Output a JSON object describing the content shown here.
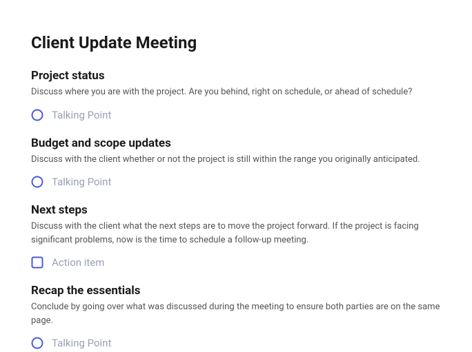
{
  "title": "Client Update Meeting",
  "sections": [
    {
      "heading": "Project status",
      "description": "Discuss where you are with the project. Are you behind, right on schedule, or ahead of schedule?",
      "item": {
        "type": "talking-point",
        "placeholder": "Talking Point"
      }
    },
    {
      "heading": "Budget and scope updates",
      "description": "Discuss with the client whether or not the project is still within the range you originally anticipated.",
      "item": {
        "type": "talking-point",
        "placeholder": "Talking Point"
      }
    },
    {
      "heading": "Next steps",
      "description": "Discuss with the client what the next steps are to move the project forward. If the project is facing significant problems, now is the time to schedule a follow-up meeting.",
      "item": {
        "type": "action-item",
        "placeholder": "Action item"
      }
    },
    {
      "heading": "Recap the essentials",
      "description": "Conclude by going over what was discussed during the meeting to ensure both parties are on the same page.",
      "item": {
        "type": "talking-point",
        "placeholder": "Talking Point"
      }
    }
  ],
  "colors": {
    "accent": "#4a5bd8"
  }
}
